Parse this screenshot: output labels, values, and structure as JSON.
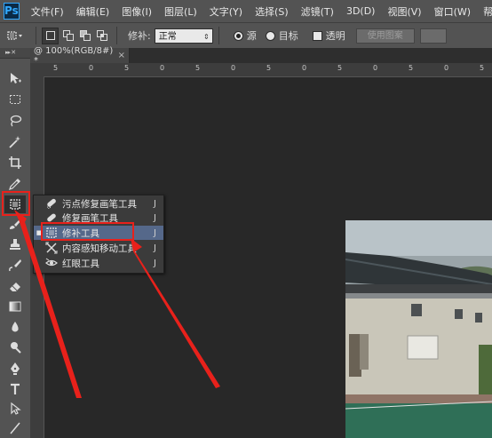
{
  "app": {
    "logo": "Ps"
  },
  "menu": [
    {
      "label": "文件(F)"
    },
    {
      "label": "编辑(E)"
    },
    {
      "label": "图像(I)"
    },
    {
      "label": "图层(L)"
    },
    {
      "label": "文字(Y)"
    },
    {
      "label": "选择(S)"
    },
    {
      "label": "滤镜(T)"
    },
    {
      "label": "3D(D)"
    },
    {
      "label": "视图(V)"
    },
    {
      "label": "窗口(W)"
    },
    {
      "label": "帮助("
    }
  ],
  "options": {
    "patch_label": "修补:",
    "mode_value": "正常",
    "source_label": "源",
    "target_label": "目标",
    "transparent_label": "透明",
    "use_pattern_label": "使用图案"
  },
  "toolbox": {
    "header": "▸▸ ✕"
  },
  "document": {
    "tab_title": "@ 100%(RGB/8#) *",
    "close_glyph": "×"
  },
  "ruler": {
    "labels": [
      "5",
      "0",
      "5",
      "0",
      "5",
      "0",
      "5",
      "0",
      "5",
      "0",
      "5",
      "0",
      "5"
    ]
  },
  "flyout": {
    "items": [
      {
        "label": "污点修复画笔工具",
        "shortcut": "J",
        "icon": "spot-healing-brush-icon",
        "active": false
      },
      {
        "label": "修复画笔工具",
        "shortcut": "J",
        "icon": "healing-brush-icon",
        "active": false
      },
      {
        "label": "修补工具",
        "shortcut": "J",
        "icon": "patch-icon",
        "active": true
      },
      {
        "label": "内容感知移动工具",
        "shortcut": "J",
        "icon": "content-aware-move-icon",
        "active": false
      },
      {
        "label": "红眼工具",
        "shortcut": "J",
        "icon": "red-eye-icon",
        "active": false
      }
    ]
  },
  "colors": {
    "highlight": "#e8211b",
    "flyout_active": "#55688a",
    "panel": "#535353",
    "canvas": "#282828"
  }
}
